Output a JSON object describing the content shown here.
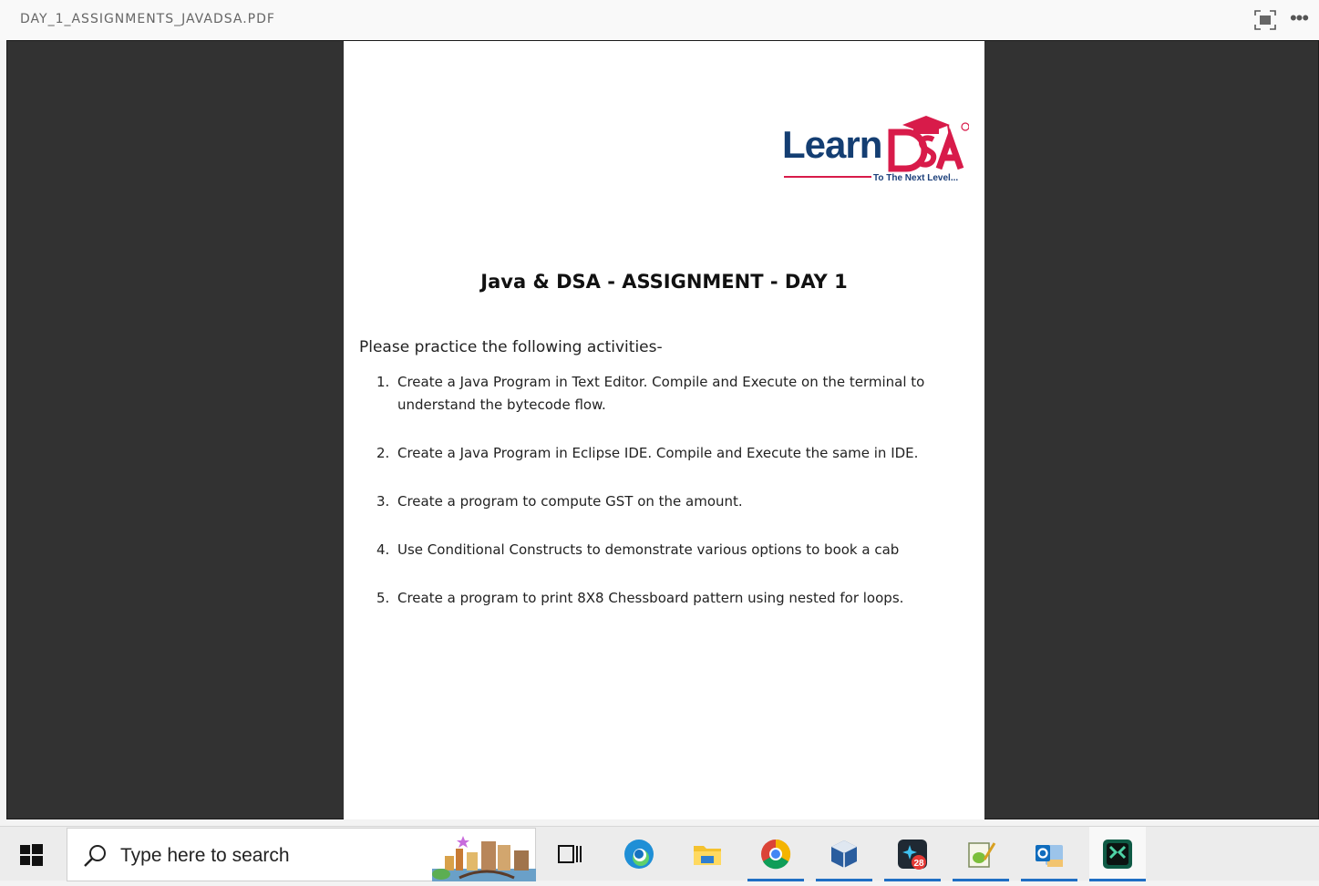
{
  "viewer": {
    "doc_title": "DAY_1_ASSIGNMENTS_JAVADSA.PDF",
    "more_label": "•••"
  },
  "document": {
    "logo_text": "Learn",
    "logo_suffix": "DSA",
    "logo_tagline": "To The Next Level...",
    "title": "Java & DSA - ASSIGNMENT - DAY 1",
    "intro": "Please practice the following activities-",
    "items": [
      {
        "num": "1.",
        "text": "Create a Java Program in Text Editor. Compile and Execute on the terminal to understand the bytecode flow."
      },
      {
        "num": "2.",
        "text": "Create a Java Program in Eclipse IDE. Compile and Execute the same in IDE."
      },
      {
        "num": "3.",
        "text": "Create a program to compute GST on the amount."
      },
      {
        "num": "4.",
        "text": "Use Conditional Constructs to demonstrate various options to book a cab"
      },
      {
        "num": "5.",
        "text": "Create a program to print 8X8 Chessboard pattern using nested for loops."
      }
    ]
  },
  "taskbar": {
    "search_placeholder": "Type here to search",
    "badge_count": "28",
    "apps": [
      "task-view",
      "edge",
      "file-explorer",
      "chrome",
      "virtualbox",
      "notification-app",
      "notepad-plus",
      "outlook",
      "excel-like-app"
    ]
  }
}
